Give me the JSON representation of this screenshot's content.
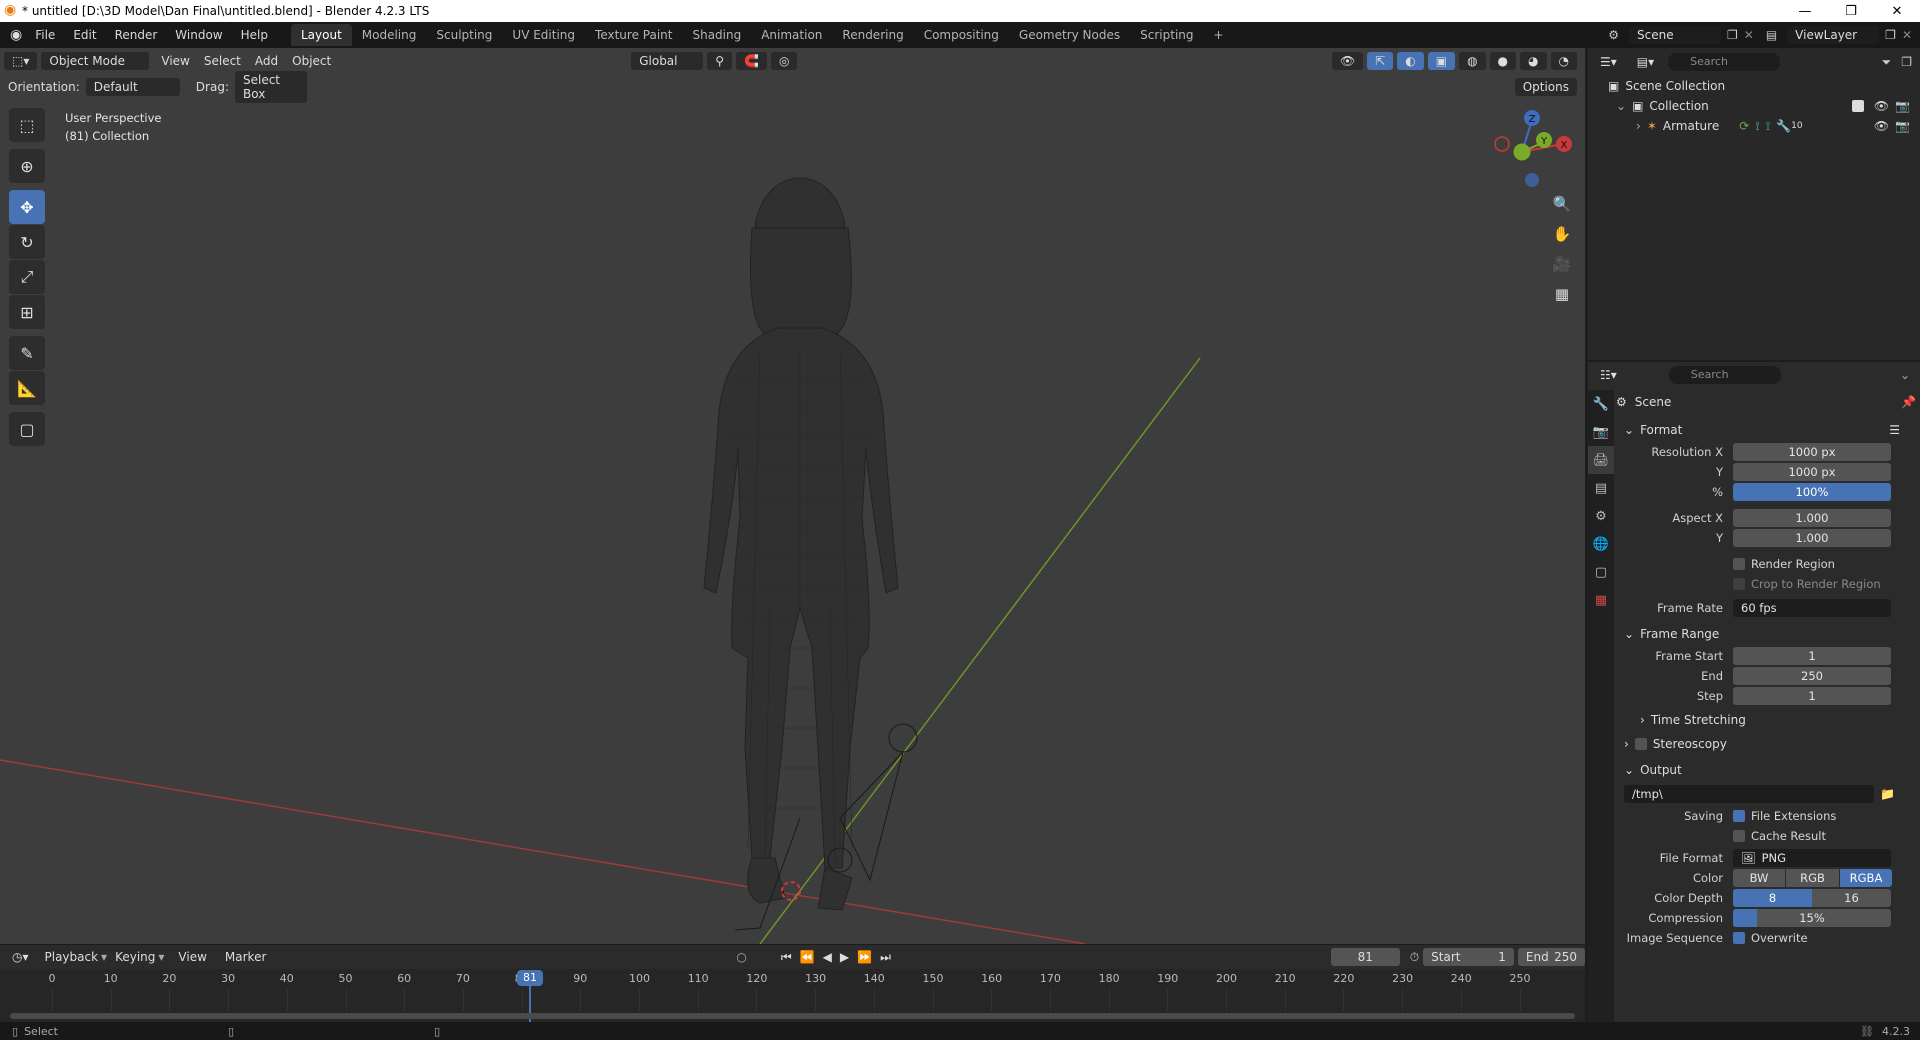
{
  "window": {
    "title": "* untitled [D:\\3D Model\\Dan Final\\untitled.blend] - Blender 4.2.3 LTS",
    "minimize": "—",
    "maximize": "❐",
    "close": "✕"
  },
  "menu": [
    "File",
    "Edit",
    "Render",
    "Window",
    "Help"
  ],
  "workspaces": [
    "Layout",
    "Modeling",
    "Sculpting",
    "UV Editing",
    "Texture Paint",
    "Shading",
    "Animation",
    "Rendering",
    "Compositing",
    "Geometry Nodes",
    "Scripting"
  ],
  "active_workspace": "Layout",
  "scene_selector": "Scene",
  "viewlayer_selector": "ViewLayer",
  "viewport": {
    "mode": "Object Mode",
    "menus": [
      "View",
      "Select",
      "Add",
      "Object"
    ],
    "transform_orientation": "Global",
    "orientation_label": "Orientation:",
    "orientation_value": "Default",
    "drag_label": "Drag:",
    "drag_value": "Select Box",
    "options": "Options",
    "overlay_text_1": "User Perspective",
    "overlay_text_2": "(81) Collection",
    "gizmo": {
      "x": "X",
      "y": "Y",
      "z": "Z"
    }
  },
  "timeline": {
    "menus": [
      "Playback",
      "Keying",
      "View",
      "Marker"
    ],
    "current_frame": "81",
    "start_label": "Start",
    "start_value": "1",
    "end_label": "End",
    "end_value": "250",
    "ticks": [
      "0",
      "10",
      "20",
      "30",
      "40",
      "50",
      "60",
      "70",
      "80",
      "90",
      "100",
      "110",
      "120",
      "130",
      "140",
      "150",
      "160",
      "170",
      "180",
      "190",
      "200",
      "210",
      "220",
      "230",
      "240",
      "250"
    ],
    "playhead_label": "81"
  },
  "status": {
    "left": "Select",
    "version": "4.2.3"
  },
  "outliner": {
    "search_placeholder": "Search",
    "scene_collection": "Scene Collection",
    "collection": "Collection",
    "armature": "Armature",
    "armature_modifier_count": "10"
  },
  "properties": {
    "search_placeholder": "Search",
    "context": "Scene",
    "format_panel": "Format",
    "resolution_x_label": "Resolution X",
    "resolution_x": "1000 px",
    "resolution_y_label": "Y",
    "resolution_y": "1000 px",
    "resolution_pct_label": "%",
    "resolution_pct": "100%",
    "aspect_x_label": "Aspect X",
    "aspect_x": "1.000",
    "aspect_y_label": "Y",
    "aspect_y": "1.000",
    "render_region": "Render Region",
    "crop_region": "Crop to Render Region",
    "frame_rate_label": "Frame Rate",
    "frame_rate": "60 fps",
    "frame_range_panel": "Frame Range",
    "frame_start_label": "Frame Start",
    "frame_start": "1",
    "frame_end_label": "End",
    "frame_end": "250",
    "frame_step_label": "Step",
    "frame_step": "1",
    "time_stretching": "Time Stretching",
    "stereoscopy": "Stereoscopy",
    "output_panel": "Output",
    "output_path": "/tmp\\",
    "saving_label": "Saving",
    "file_extensions": "File Extensions",
    "cache_result": "Cache Result",
    "file_format_label": "File Format",
    "file_format": "PNG",
    "color_label": "Color",
    "color_bw": "BW",
    "color_rgb": "RGB",
    "color_rgba": "RGBA",
    "color_depth_label": "Color Depth",
    "depth_8": "8",
    "depth_16": "16",
    "compression_label": "Compression",
    "compression": "15%",
    "compression_fraction": 0.15,
    "image_sequence_label": "Image Sequence",
    "overwrite": "Overwrite"
  }
}
